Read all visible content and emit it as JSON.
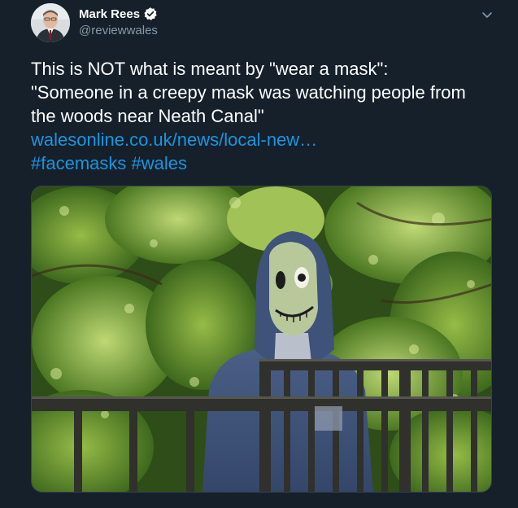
{
  "author": {
    "display_name": "Mark Rees",
    "handle": "@reviewwales",
    "verified_icon": "verified-badge-icon",
    "avatar_icon": "avatar"
  },
  "menu": {
    "icon": "chevron-down-icon"
  },
  "tweet": {
    "line1": "This is NOT what is meant by \"wear a mask\":",
    "line2": "\"Someone in a creepy mask was watching people from",
    "line3": "the woods near Neath Canal\"",
    "link": "walesonline.co.uk/news/local-new…",
    "hashtag1": "#facemasks",
    "hashtag2": "#wales"
  },
  "media": {
    "description_icon": "photo-masked-person-in-woods"
  },
  "colors": {
    "background": "#15202b",
    "text": "#ffffff",
    "secondary": "#8899a6",
    "link": "#1b95e0",
    "verified": "#ffffff"
  }
}
